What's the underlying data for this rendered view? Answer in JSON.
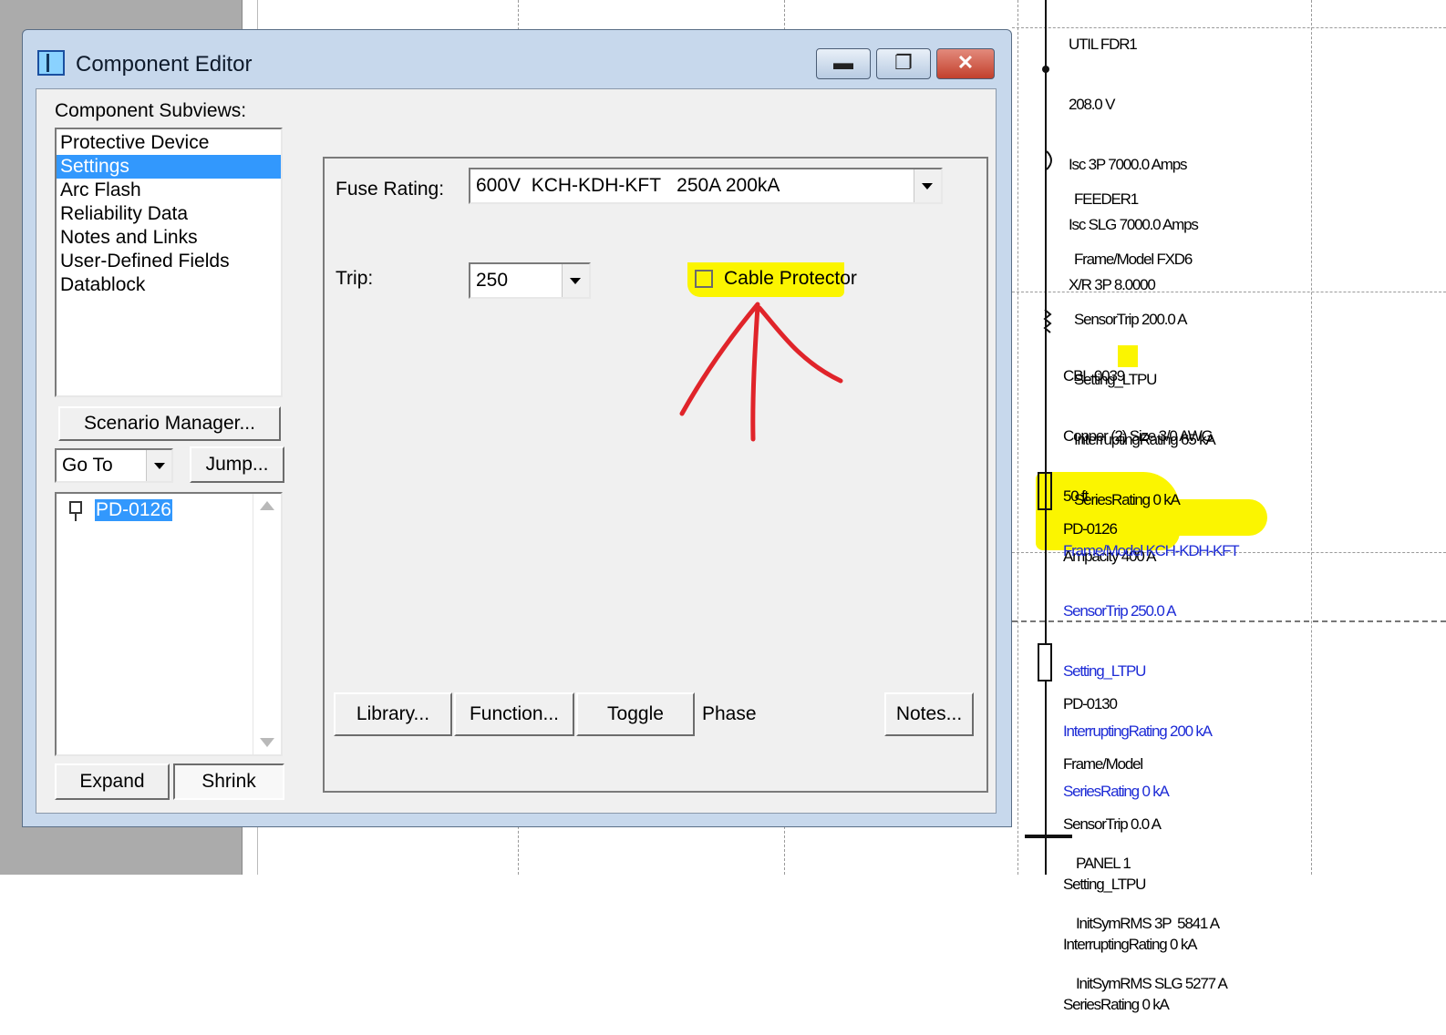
{
  "dialog": {
    "title": "Component Editor",
    "subviews_label": "Component Subviews:",
    "subviews": [
      {
        "label": "Protective Device",
        "selected": false
      },
      {
        "label": "Settings",
        "selected": true
      },
      {
        "label": "Arc Flash",
        "selected": false
      },
      {
        "label": "Reliability Data",
        "selected": false
      },
      {
        "label": "Notes and Links",
        "selected": false
      },
      {
        "label": "User-Defined Fields",
        "selected": false
      },
      {
        "label": "Datablock",
        "selected": false
      }
    ],
    "scenario_button": "Scenario Manager...",
    "goto_value": "Go To",
    "jump_button": "Jump...",
    "tree_item": "PD-0126",
    "expand_button": "Expand",
    "shrink_button": "Shrink",
    "fuse_rating_label": "Fuse Rating:",
    "fuse_rating_value": "600V  KCH-KDH-KFT   250A 200kA",
    "trip_label": "Trip:",
    "trip_value": "250",
    "cable_protector_label": "Cable Protector",
    "cable_protector_checked": false,
    "library_button": "Library...",
    "function_button": "Function...",
    "toggle_button": "Toggle",
    "phase_label": "Phase",
    "notes_button": "Notes..."
  },
  "oneline": {
    "util": [
      "UTIL FDR1",
      "208.0 V",
      "Isc 3P 7000.0 Amps",
      "Isc SLG 7000.0 Amps",
      "X/R 3P 8.0000"
    ],
    "feeder": [
      "FEEDER1",
      "Frame/Model FXD6",
      "SensorTrip 200.0 A",
      "Setting_LTPU",
      "InterruptingRating 65 kA",
      "SeriesRating 0 kA"
    ],
    "cable": [
      "CBL-0039",
      "Copper (2) Size 3/0 AWG",
      "50 ft",
      "Ampacity 400 A"
    ],
    "pd0126_name": "PD-0126",
    "pd0126": [
      "Frame/Model KCH-KDH-KFT",
      "SensorTrip 250.0 A",
      "Setting_LTPU",
      "InterruptingRating 200 kA",
      "SeriesRating 0 kA"
    ],
    "pd0130": [
      "PD-0130",
      "Frame/Model",
      "SensorTrip 0.0 A",
      "Setting_LTPU",
      "InterruptingRating 0 kA",
      "SeriesRating 0 kA"
    ],
    "panel": [
      "PANEL 1",
      "InitSymRMS 3P  5841 A",
      "InitSymRMS SLG 5277 A"
    ]
  },
  "colors": {
    "highlight": "#fbf500",
    "selection": "#3298fd",
    "annotation_arrow": "#e0242a",
    "blue_text": "#1d2bd6"
  }
}
